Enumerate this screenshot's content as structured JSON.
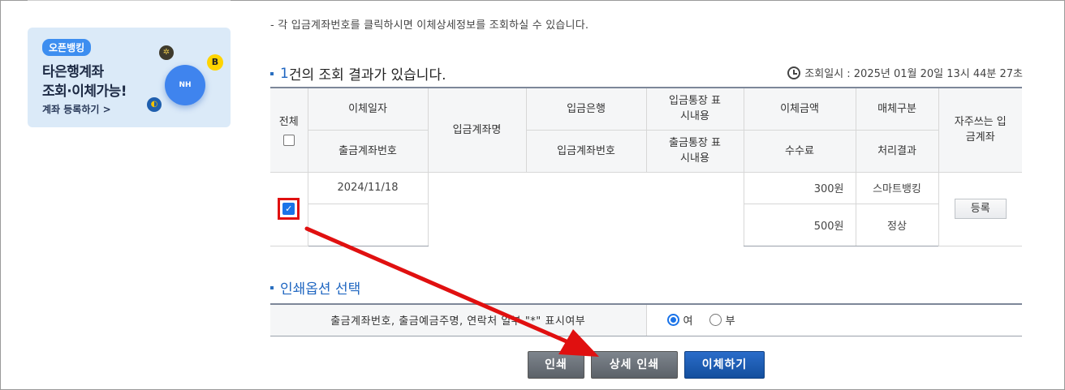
{
  "banner": {
    "badge": "오픈뱅킹",
    "line1": "타은행계좌",
    "line2": "조회·이체가능!",
    "link": "계좌 등록하기 >",
    "nh_label": "NH",
    "coin_b": "B"
  },
  "notice": "- 각 입금계좌번호를 클릭하시면 이체상세정보를 조회하실 수 있습니다.",
  "result": {
    "count": "1",
    "suffix": "건의 조회 결과가 있습니다.",
    "timestamp_label": "조회일시 : 2025년 01월 20일 13시 44분 27초"
  },
  "table": {
    "headers": {
      "all": "전체",
      "transfer_date": "이체일자",
      "out_account": "출금계좌번호",
      "dest_name": "입금계좌명",
      "dest_bank": "입금은행",
      "dest_account": "입금계좌번호",
      "dest_memo": "입금통장 표시내용",
      "out_memo": "출금통장 표시내용",
      "amount": "이체금액",
      "fee": "수수료",
      "channel": "매체구분",
      "status": "처리결과",
      "favorite": "자주쓰는 입금계좌"
    },
    "row": {
      "date": "2024/11/18",
      "amount": "300원",
      "fee": "500원",
      "channel": "스마트뱅킹",
      "status": "정상",
      "register_button": "등록",
      "checked": true
    }
  },
  "print_options": {
    "title": "인쇄옵션 선택",
    "label": "출금계좌번호, 출금예금주명, 연락처 일부 \"*\" 표시여부",
    "yes": "여",
    "no": "부",
    "selected": "yes"
  },
  "buttons": {
    "print": "인쇄",
    "detail_print": "상세 인쇄",
    "transfer": "이체하기"
  },
  "colors": {
    "accent_blue": "#1f66c1",
    "highlight_red": "#e01010"
  }
}
